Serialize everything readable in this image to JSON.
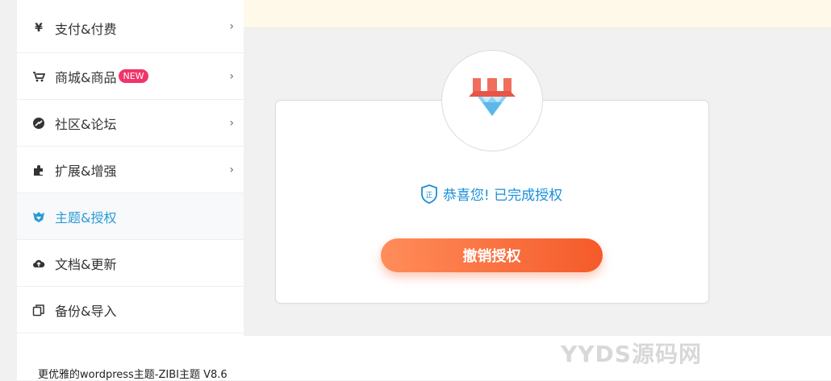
{
  "sidebar": {
    "items": [
      {
        "label": "支付&付费",
        "icon": "yen-icon",
        "chevron": "›"
      },
      {
        "label": "商城&商品",
        "icon": "cart-icon",
        "badge": "NEW",
        "chevron": "›"
      },
      {
        "label": "社区&论坛",
        "icon": "community-icon",
        "chevron": "›"
      },
      {
        "label": "扩展&增强",
        "icon": "puzzle-icon",
        "chevron": "›"
      },
      {
        "label": "主题&授权",
        "icon": "theme-icon",
        "active": true
      },
      {
        "label": "文档&更新",
        "icon": "cloud-upload-icon"
      },
      {
        "label": "备份&导入",
        "icon": "backup-icon"
      }
    ]
  },
  "auth": {
    "message": "恭喜您! 已完成授权",
    "revoke_label": "撤销授权"
  },
  "footer": {
    "text": "更优雅的wordpress主题-ZIBI主题 V8.6"
  },
  "watermark": "YYDS源码网",
  "colors": {
    "accent_blue": "#1a8fd8",
    "button_orange": "#f55a2a",
    "badge_pink": "#f0356a",
    "banner_yellow": "#fef9e8"
  }
}
